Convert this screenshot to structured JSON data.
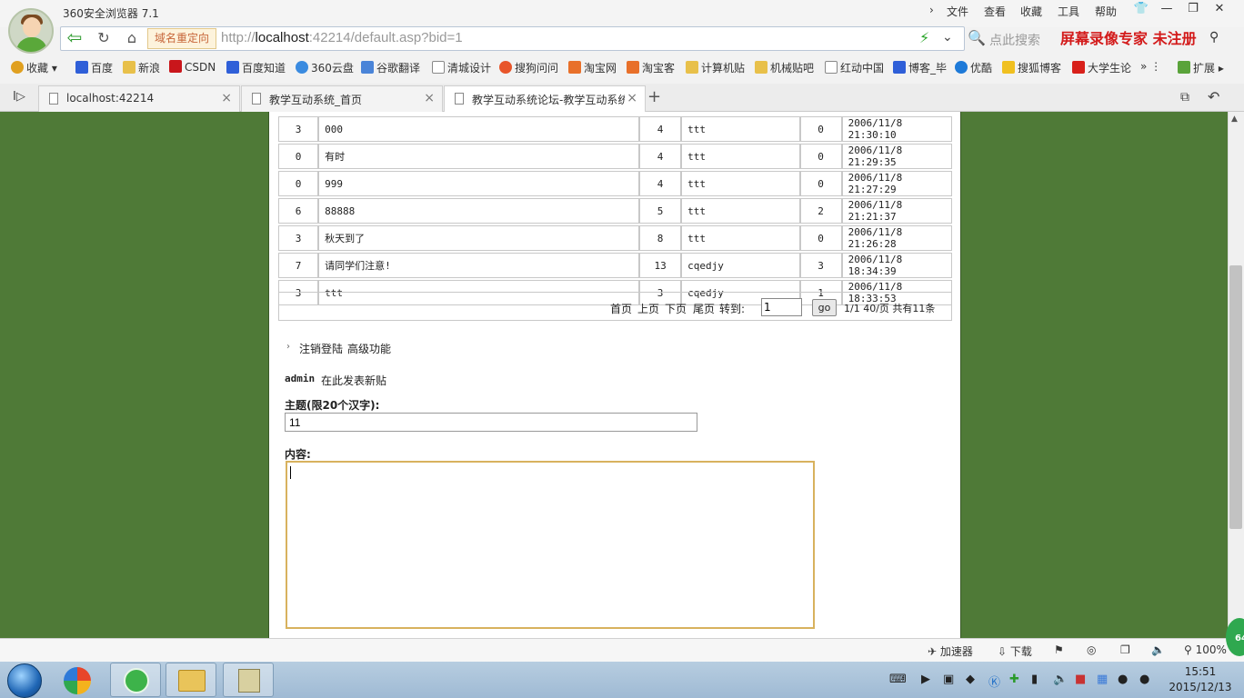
{
  "browser": {
    "title": "360安全浏览器 7.1",
    "menu": [
      "文件",
      "查看",
      "收藏",
      "工具",
      "帮助"
    ],
    "redirect_label": "域名重定向",
    "url_prefix": "http://",
    "url_host": "localhost",
    "url_rest": ":42214/default.asp?bid=1",
    "search_placeholder": "点此搜索",
    "watermark": "屏幕录像专家  未注册"
  },
  "bookmarks": [
    {
      "label": "收藏",
      "color": "#e0a020"
    },
    {
      "label": "百度",
      "color": "#2f5fd8"
    },
    {
      "label": "新浪",
      "color": "#e8c04a"
    },
    {
      "label": "CSDN",
      "color": "#c9161b"
    },
    {
      "label": "百度知道",
      "color": "#2f5fd8"
    },
    {
      "label": "360云盘",
      "color": "#3a8be0"
    },
    {
      "label": "谷歌翻译",
      "color": "#4a84d8"
    },
    {
      "label": "清城设计",
      "color": "#ffffff"
    },
    {
      "label": "搜狗问问",
      "color": "#e8552a"
    },
    {
      "label": "淘宝网",
      "color": "#e8702a"
    },
    {
      "label": "淘宝客",
      "color": "#e8702a"
    },
    {
      "label": "计算机贴",
      "color": "#e8c04a"
    },
    {
      "label": "机械贴吧",
      "color": "#e8c04a"
    },
    {
      "label": "红动中国",
      "color": "#ffffff"
    },
    {
      "label": "博客_毕",
      "color": "#2f5fd8"
    },
    {
      "label": "优酷",
      "color": "#1e7ad8"
    },
    {
      "label": "搜狐博客",
      "color": "#f0c020"
    },
    {
      "label": "大学生论",
      "color": "#d8201a"
    },
    {
      "label": "扩展",
      "color": "#5aa33a"
    }
  ],
  "tabs": [
    {
      "label": "localhost:42214"
    },
    {
      "label": "教学互动系统_首页"
    },
    {
      "label": "教学互动系统论坛-教学互动系统"
    }
  ],
  "topics": [
    {
      "replies": "3",
      "title": "000",
      "hits": "4",
      "author": "ttt",
      "n": "0",
      "time": "2006/11/8 21:30:10"
    },
    {
      "replies": "0",
      "title": "有时",
      "hits": "4",
      "author": "ttt",
      "n": "0",
      "time": "2006/11/8 21:29:35"
    },
    {
      "replies": "0",
      "title": "999",
      "hits": "4",
      "author": "ttt",
      "n": "0",
      "time": "2006/11/8 21:27:29"
    },
    {
      "replies": "6",
      "title": "88888",
      "hits": "5",
      "author": "ttt",
      "n": "2",
      "time": "2006/11/8 21:21:37"
    },
    {
      "replies": "3",
      "title": "秋天到了",
      "hits": "8",
      "author": "ttt",
      "n": "0",
      "time": "2006/11/8 21:26:28"
    },
    {
      "replies": "7",
      "title": "请同学们注意!",
      "hits": "13",
      "author": "cqedjy",
      "n": "3",
      "time": "2006/11/8 18:34:39"
    },
    {
      "replies": "3",
      "title": "ttt",
      "hits": "3",
      "author": "cqedjy",
      "n": "1",
      "time": "2006/11/8 18:33:53"
    }
  ],
  "pager": {
    "first": "首页",
    "prev": "上页",
    "next": "下页",
    "last": "尾页",
    "goto": "转到:",
    "page_value": "1",
    "go": "go",
    "info": "1/1 40/页 共有11条"
  },
  "form": {
    "arrow": "›",
    "logout": "注销登陆",
    "advanced": "高级功能",
    "user": "admin",
    "post_hint": "在此发表新贴",
    "subject_label": "主题(限20个汉字):",
    "subject_value": "11",
    "content_label": "内容:"
  },
  "status": {
    "accelerator": "加速器",
    "download": "下载",
    "zoom": "100%",
    "badge": "64"
  },
  "clock": {
    "time": "15:51",
    "date": "2015/12/13"
  }
}
